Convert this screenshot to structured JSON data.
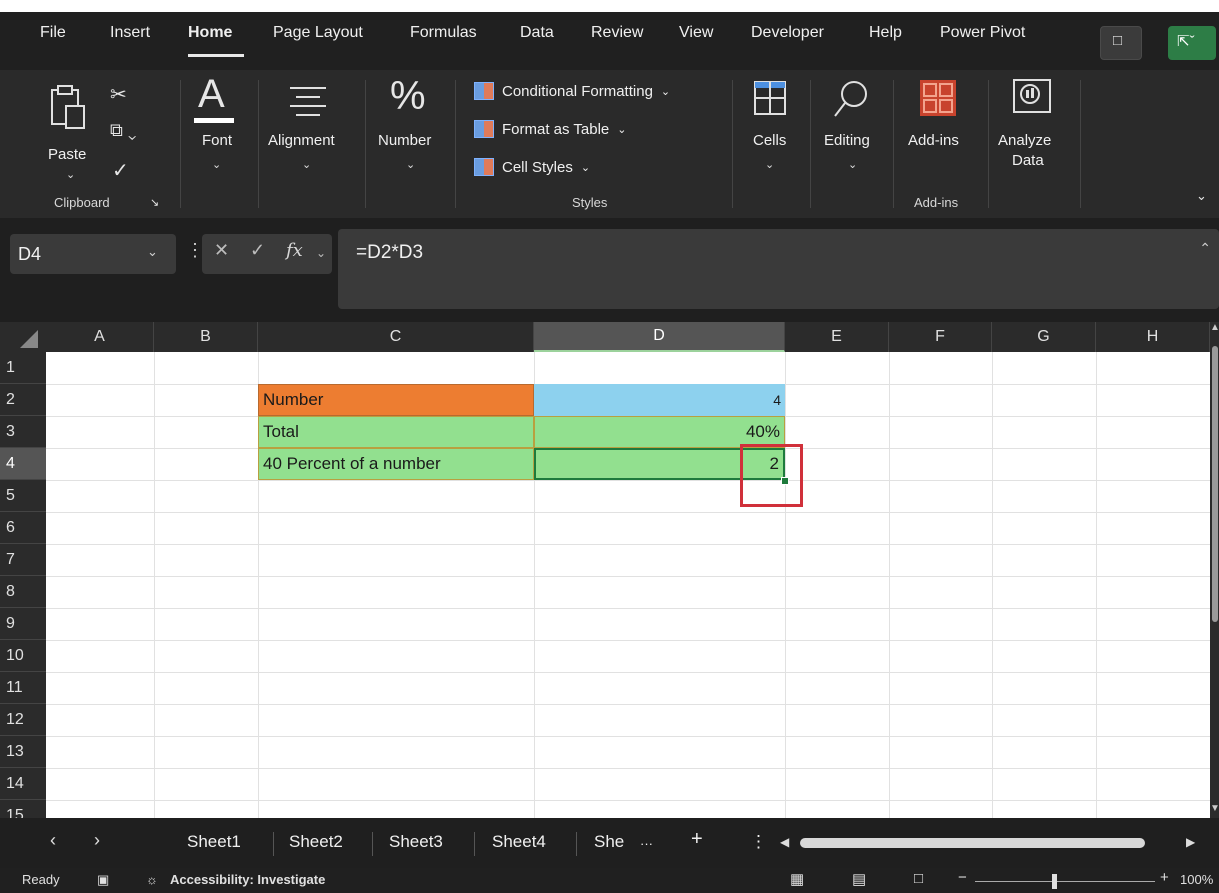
{
  "menu": {
    "items": [
      "File",
      "Insert",
      "Home",
      "Page Layout",
      "Formulas",
      "Data",
      "Review",
      "View",
      "Developer",
      "Help",
      "Power Pivot"
    ],
    "active": "Home"
  },
  "ribbon": {
    "clipboard": {
      "paste": "Paste",
      "group": "Clipboard"
    },
    "font": {
      "label": "Font"
    },
    "alignment": {
      "label": "Alignment"
    },
    "number": {
      "label": "Number"
    },
    "styles": {
      "conditional": "Conditional Formatting",
      "format_table": "Format as Table",
      "cell_styles": "Cell Styles",
      "group": "Styles"
    },
    "cells": {
      "label": "Cells"
    },
    "editing": {
      "label": "Editing"
    },
    "addins": {
      "label": "Add-ins",
      "group": "Add-ins"
    },
    "analyze": {
      "label1": "Analyze",
      "label2": "Data"
    }
  },
  "formula_bar": {
    "name_box": "D4",
    "formula": "=D2*D3",
    "fx": "fx"
  },
  "grid": {
    "columns": [
      "A",
      "B",
      "C",
      "D",
      "E",
      "F",
      "G",
      "H"
    ],
    "rows": [
      "1",
      "2",
      "3",
      "4",
      "5",
      "6",
      "7",
      "8",
      "9",
      "10",
      "11",
      "12",
      "13",
      "14",
      "15"
    ],
    "selected_cell": "D4",
    "cells": {
      "C2": "Number",
      "D2": "4",
      "C3": "Total",
      "D3": "40%",
      "C4": "40 Percent of a number",
      "D4": "2"
    },
    "colors": {
      "orange": "#ED7D31",
      "blue": "#8DD1EE",
      "green": "#92E08F"
    }
  },
  "sheets": {
    "tabs": [
      "Sheet1",
      "Sheet2",
      "Sheet3",
      "Sheet4",
      "She"
    ],
    "overflow": "···",
    "add": "+"
  },
  "status": {
    "ready": "Ready",
    "accessibility": "Accessibility: Investigate",
    "zoom": "100%"
  }
}
